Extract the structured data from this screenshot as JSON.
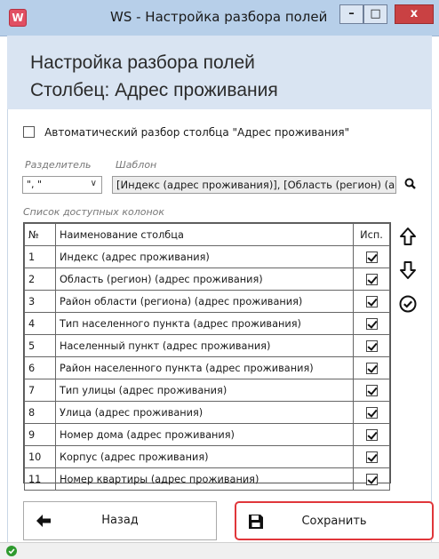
{
  "window": {
    "title": "WS - Настройка разбора полей",
    "app_icon_letter": "W",
    "controls": {
      "minimize": "–",
      "maximize": "□",
      "close": "x"
    },
    "close_color": "#c94143"
  },
  "header": {
    "line1": "Настройка разбора полей",
    "line2": "Столбец: Адрес проживания"
  },
  "auto_parse": {
    "label": "Автоматический разбор столбца \"Адрес проживания\"",
    "checked": false
  },
  "separator": {
    "label": "Разделитель",
    "value": "\", \""
  },
  "template": {
    "label": "Шаблон",
    "value": "[Индекс (адрес проживания)], [Область (регион) (а"
  },
  "columns_list": {
    "label": "Список доступных колонок",
    "headers": {
      "num": "№",
      "name": "Наименование столбца",
      "use": "Исп."
    },
    "rows": [
      {
        "num": "1",
        "name": "Индекс (адрес проживания)",
        "used": true
      },
      {
        "num": "2",
        "name": "Область (регион) (адрес проживания)",
        "used": true
      },
      {
        "num": "3",
        "name": "Район области (региона) (адрес проживания)",
        "used": true
      },
      {
        "num": "4",
        "name": "Тип населенного пункта (адрес проживания)",
        "used": true
      },
      {
        "num": "5",
        "name": "Населенный пункт (адрес проживания)",
        "used": true
      },
      {
        "num": "6",
        "name": "Район населенного пункта (адрес проживания)",
        "used": true
      },
      {
        "num": "7",
        "name": "Тип улицы (адрес проживания)",
        "used": true
      },
      {
        "num": "8",
        "name": "Улица (адрес проживания)",
        "used": true
      },
      {
        "num": "9",
        "name": "Номер дома (адрес проживания)",
        "used": true
      },
      {
        "num": "10",
        "name": "Корпус (адрес проживания)",
        "used": true
      },
      {
        "num": "11",
        "name": "Номер квартиры (адрес проживания)",
        "used": true
      }
    ]
  },
  "side_buttons": [
    "arrow-up-icon",
    "arrow-down-icon",
    "check-circle-icon"
  ],
  "buttons": {
    "back": "Назад",
    "save": "Сохранить"
  },
  "highlight_color": "#e0363a",
  "status": {
    "icon": "ok-check-icon",
    "color": "#2e9a2e"
  }
}
